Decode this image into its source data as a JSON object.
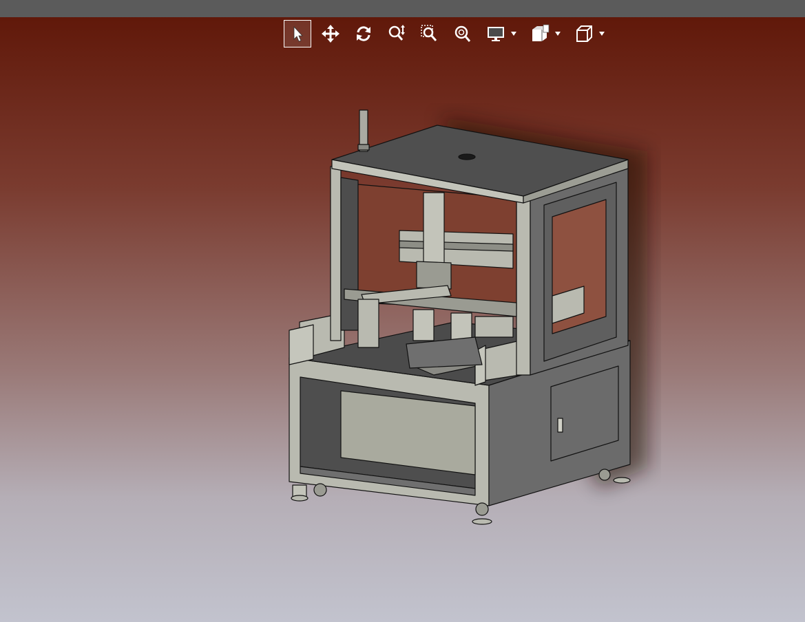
{
  "toolbar": {
    "tools": [
      {
        "id": "select",
        "icon": "cursor-arrow-icon",
        "active": true
      },
      {
        "id": "pan",
        "icon": "pan-arrows-icon",
        "active": false
      },
      {
        "id": "rotate",
        "icon": "rotate-icon",
        "active": false
      },
      {
        "id": "zoom",
        "icon": "zoom-icon",
        "active": false
      },
      {
        "id": "zoom-window",
        "icon": "zoom-window-icon",
        "active": false
      },
      {
        "id": "zoom-fit",
        "icon": "zoom-fit-icon",
        "active": false
      },
      {
        "id": "display",
        "icon": "monitor-icon",
        "dropdown": true
      },
      {
        "id": "section",
        "icon": "section-view-icon",
        "dropdown": true
      },
      {
        "id": "view-orientation",
        "icon": "cube-view-icon",
        "dropdown": true
      }
    ]
  },
  "colors": {
    "topbar": "#5b5b5b",
    "background_top": "#5e1506",
    "background_bottom": "#c2c3ce",
    "model_frame": "#b9bab0",
    "model_panel": "#6b6b6b"
  }
}
